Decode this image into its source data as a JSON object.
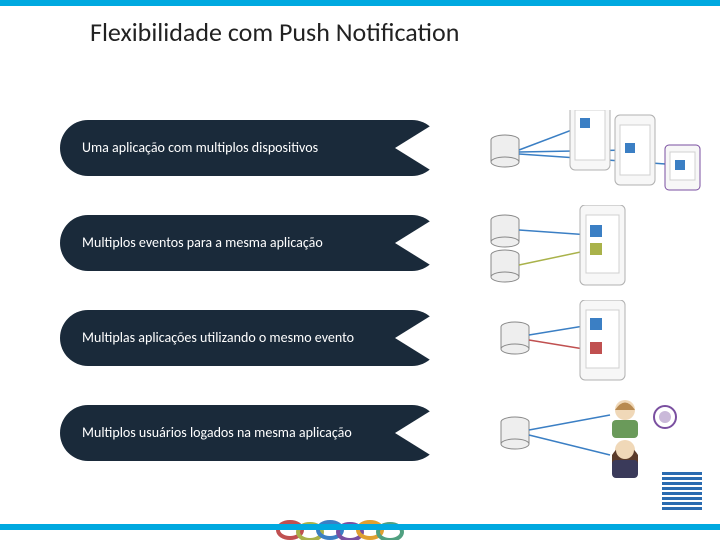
{
  "title": "Flexibilidade com Push Notification",
  "points": [
    {
      "label": "Uma aplicação com multiplos dispositivos"
    },
    {
      "label": "Multiplos eventos para a mesma aplicação"
    },
    {
      "label": "Multiplas aplicações utilizando o mesmo evento"
    },
    {
      "label": "Multiplos usuários logados na mesma aplicação"
    }
  ],
  "colors": {
    "accent": "#00a9e0",
    "pill": "#1a2a3a",
    "blue": "#3b7fc4",
    "olive": "#a9b24a",
    "red": "#c05050",
    "purple": "#7a4fa0",
    "devStroke": "#b0b0b0"
  }
}
